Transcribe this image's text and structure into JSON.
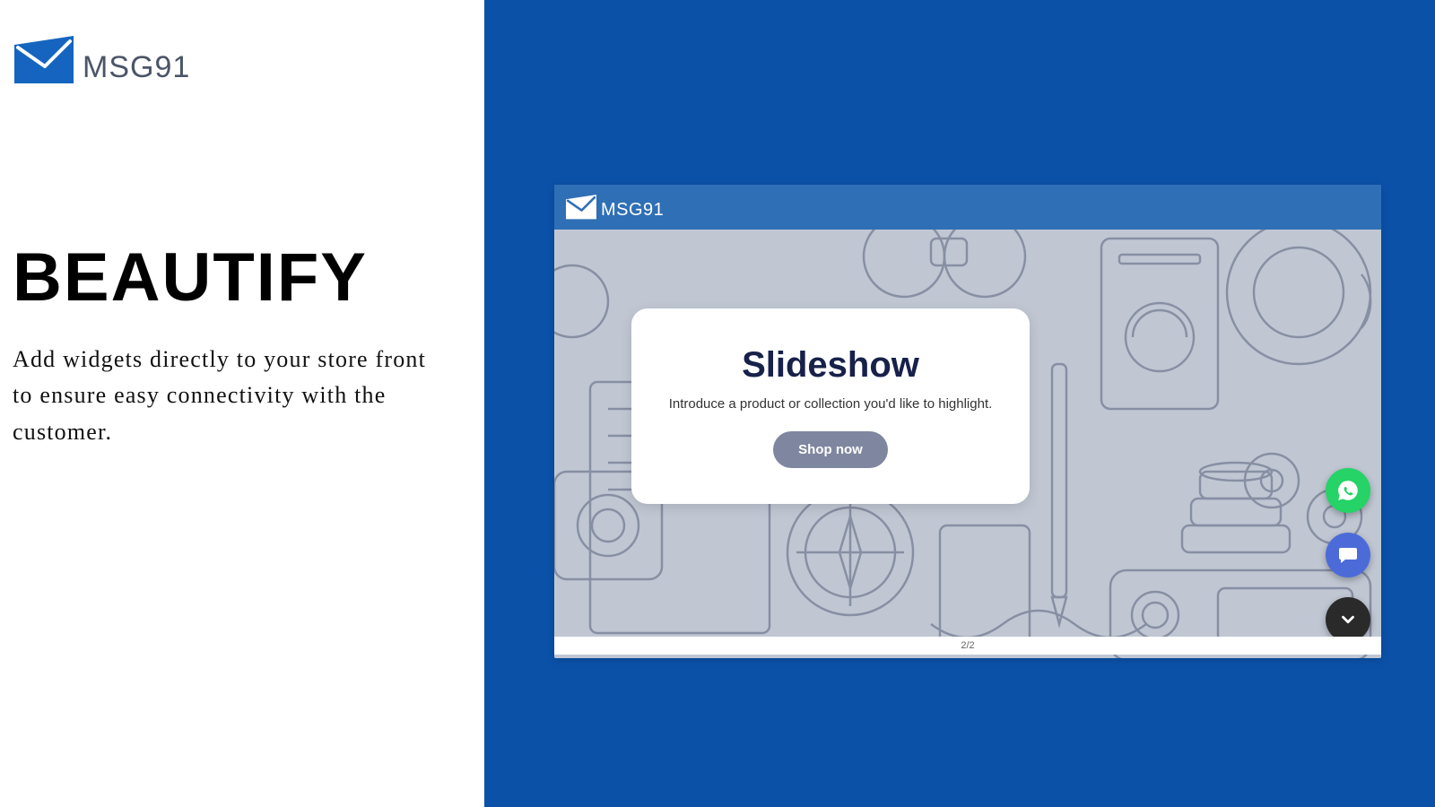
{
  "brand": {
    "name": "MSG91"
  },
  "left": {
    "headline": "BEAUTIFY",
    "subtext": "Add widgets directly to your store front to ensure easy connectivity with the customer."
  },
  "preview": {
    "card": {
      "title": "Slideshow",
      "desc": "Introduce a product or collection you'd like to highlight.",
      "button": "Shop now"
    },
    "pager": "2/2"
  },
  "colors": {
    "brand_blue": "#0b51a8",
    "topbar_blue": "#2f6fb6",
    "whatsapp": "#25d366",
    "chat": "#4c6bd9",
    "dark": "#2a2a2a"
  }
}
